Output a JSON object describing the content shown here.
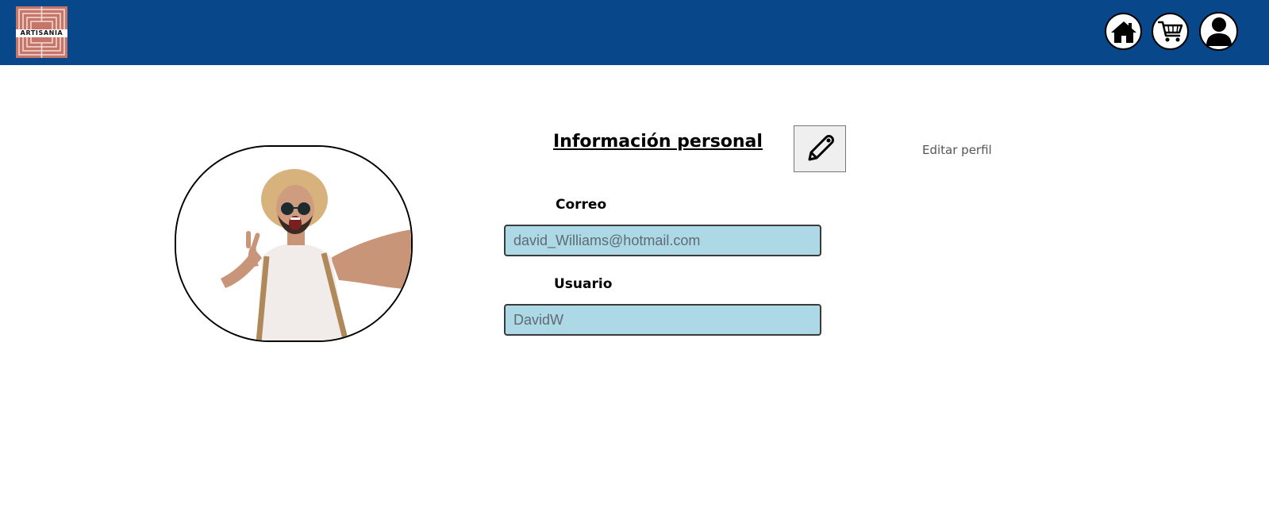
{
  "header": {
    "logo_text": "ARTISANIA",
    "logo_color": "#c67668",
    "background": "#07478a",
    "icons": [
      "home-icon",
      "cart-icon",
      "user-icon"
    ]
  },
  "profile": {
    "section_title": "Información personal",
    "edit_label": "Editar perfil",
    "edit_icon": "pencil-icon",
    "fields": [
      {
        "label": "Correo",
        "value": "david_Williams@hotmail.com"
      },
      {
        "label": "Usuario",
        "value": "DavidW"
      }
    ],
    "input_background": "#add8e6"
  }
}
